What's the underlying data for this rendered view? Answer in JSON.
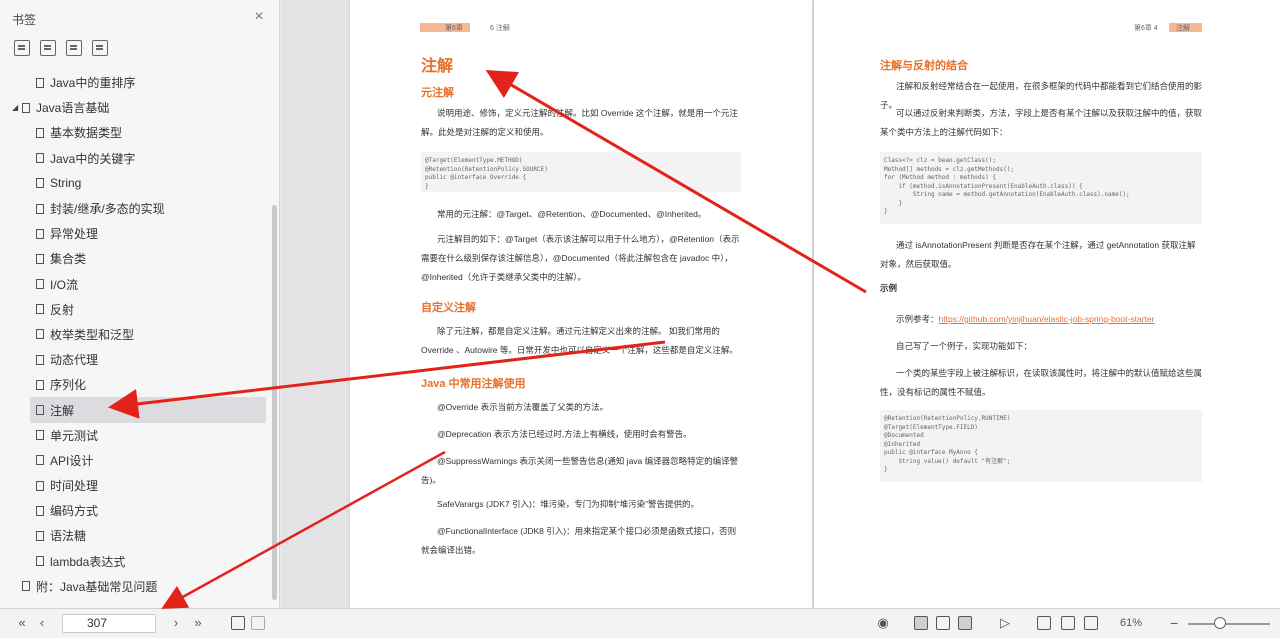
{
  "sidebar": {
    "title": "书签",
    "close": "×",
    "items": [
      {
        "label": "Java中的重排序",
        "level": 2
      },
      {
        "label": "Java语言基础",
        "level": 1,
        "expanded": true
      },
      {
        "label": "基本数据类型",
        "level": 2
      },
      {
        "label": "Java中的关键字",
        "level": 2
      },
      {
        "label": "String",
        "level": 2
      },
      {
        "label": "封装/继承/多态的实现",
        "level": 2
      },
      {
        "label": "异常处理",
        "level": 2
      },
      {
        "label": "集合类",
        "level": 2
      },
      {
        "label": "I/O流",
        "level": 2
      },
      {
        "label": "反射",
        "level": 2
      },
      {
        "label": "枚举类型和泛型",
        "level": 2
      },
      {
        "label": "动态代理",
        "level": 2
      },
      {
        "label": "序列化",
        "level": 2
      },
      {
        "label": "注解",
        "level": 2,
        "active": true
      },
      {
        "label": "单元测试",
        "level": 2
      },
      {
        "label": "API设计",
        "level": 2
      },
      {
        "label": "时间处理",
        "level": 2
      },
      {
        "label": "编码方式",
        "level": 2
      },
      {
        "label": "语法糖",
        "level": 2
      },
      {
        "label": "lambda表达式",
        "level": 2
      },
      {
        "label": "附：Java基础常见问题",
        "level": 1
      }
    ]
  },
  "left_page": {
    "header_left": "第6章",
    "header_right": "6 注解",
    "title": "注解",
    "s1_title": "元注解",
    "s1_p1": "说明用途、修饰，定义元注解的注解。比如 Override 这个注解，就是用一个元注解。此处是对注解的定义和使用。",
    "code1": "@Target(ElementType.METHOD)\n@Retention(RetentionPolicy.SOURCE)\npublic @interface Override {\n}",
    "s1_p2": "常用的元注解：@Target、@Retention、@Documented、@Inherited。",
    "s1_p3": "元注解目的如下：@Target（表示该注解可以用于什么地方），@Retention（表示需要在什么级别保存该注解信息），@Documented（将此注解包含在 javadoc 中），@Inherited（允许子类继承父类中的注解）。",
    "s2_title": "自定义注解",
    "s2_p1": "除了元注解，都是自定义注解。通过元注解定义出来的注解。 如我们常用的 Override 、Autowire 等。日常开发中也可以自定义一个注解，这些都是自定义注解。",
    "s3_title": "Java 中常用注解使用",
    "s3_i1": "@Override 表示当前方法覆盖了父类的方法。",
    "s3_i2": "@Deprecation 表示方法已经过时,方法上有横线，使用时会有警告。",
    "s3_i3": "@SuppressWarnings 表示关闭一些警告信息(通知 java 编译器忽略特定的编译警告)。",
    "s3_i4": "SafeVarargs (JDK7 引入)：堆污染，专门为抑制“堆污染”警告提供的。",
    "s3_i5": "@FunctionalInterface (JDK8 引入)：用来指定某个接口必须是函数式接口，否则就会编译出错。"
  },
  "right_page": {
    "header_left": "第6章 4",
    "header_right": "注解",
    "title": "注解与反射的结合",
    "p1": "注解和反射经常结合在一起使用，在很多框架的代码中都能看到它们结合使用的影子。",
    "p2": "可以通过反射来判断类，方法，字段上是否有某个注解以及获取注解中的值，获取某个类中方法上的注解代码如下：",
    "code1": "Class<?> clz = bean.getClass();\nMethod[] methods = clz.getMethods();\nfor (Method method : methods) {\n    if (method.isAnnotationPresent(EnableAuth.class)) {\n        String name = method.getAnnotation(EnableAuth.class).name();\n    }\n}",
    "p3": "通过 isAnnotationPresent 判断是否存在某个注解，通过 getAnnotation 获取注解对象，然后获取值。",
    "example_label": "示例",
    "p4_prefix": "示例参考：",
    "p4_link": "https://github.com/yinjihuan/elastic-job-spring-boot-starter",
    "p5": "自己写了一个例子，实现功能如下：",
    "p6": "一个类的某些字段上被注解标识，在读取该属性时，将注解中的默认值赋给这些属性，没有标记的属性不赋值。",
    "code2": "@Retention(RetentionPolicy.RUNTIME)\n@Target(ElementType.FIELD)\n@Documented\n@Inherited\npublic @interface MyAnno {\n    String value() default \"有注解\";\n}"
  },
  "bottom": {
    "page_number": "307",
    "zoom": "61%"
  }
}
